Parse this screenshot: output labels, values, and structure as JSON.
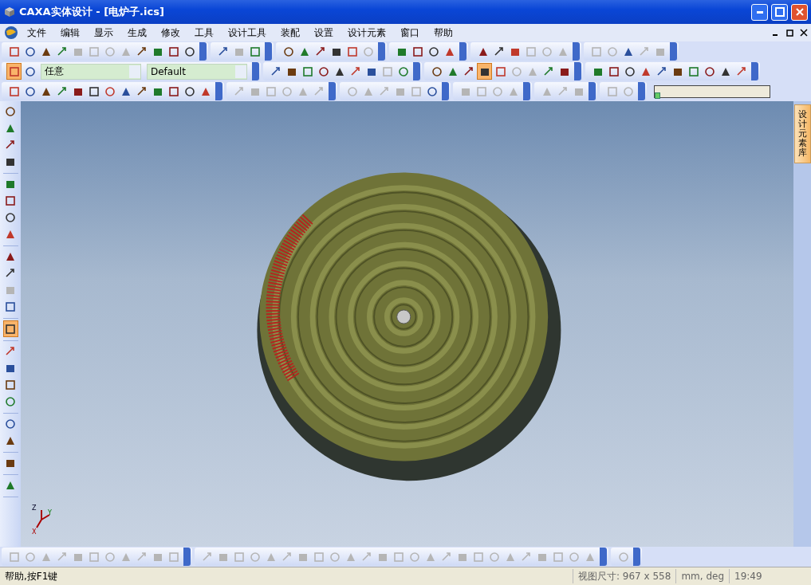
{
  "window": {
    "title": "CAXA实体设计 - [电炉子.ics]"
  },
  "menu": [
    "文件",
    "编辑",
    "显示",
    "生成",
    "修改",
    "工具",
    "设计工具",
    "装配",
    "设置",
    "设计元素",
    "窗口",
    "帮助"
  ],
  "toolbar_rows": [
    [
      {
        "items": [
          {
            "disabled": false
          },
          {
            "disabled": false
          },
          {
            "disabled": false
          },
          {
            "disabled": false
          },
          {
            "disabled": true
          },
          {
            "disabled": true
          },
          {
            "disabled": true
          },
          {
            "disabled": true
          },
          {
            "disabled": false
          },
          {
            "disabled": false
          },
          {
            "disabled": false
          },
          {
            "disabled": false
          }
        ]
      },
      {
        "items": [
          {
            "disabled": false
          },
          {
            "disabled": true
          },
          {
            "disabled": false
          }
        ]
      },
      {
        "items": [
          {
            "disabled": false
          },
          {
            "disabled": false
          },
          {
            "disabled": false
          },
          {
            "disabled": false
          },
          {
            "disabled": false
          },
          {
            "disabled": true
          }
        ]
      },
      {
        "items": [
          {
            "disabled": false
          },
          {
            "disabled": false
          },
          {
            "disabled": false
          },
          {
            "disabled": false
          }
        ]
      },
      {
        "items": [
          {
            "disabled": false
          },
          {
            "disabled": false
          },
          {
            "disabled": false
          },
          {
            "disabled": true
          },
          {
            "disabled": true
          },
          {
            "disabled": true
          }
        ]
      },
      {
        "items": [
          {
            "disabled": true
          },
          {
            "disabled": true
          },
          {
            "disabled": false
          },
          {
            "disabled": true
          },
          {
            "disabled": true
          }
        ]
      }
    ],
    [
      {
        "items": [
          {
            "disabled": false,
            "selected": true
          },
          {
            "disabled": false,
            "selected": false
          }
        ]
      },
      {
        "items": [
          {
            "disabled": false
          },
          {
            "disabled": false
          },
          {
            "disabled": false
          },
          {
            "disabled": false
          },
          {
            "disabled": false
          },
          {
            "disabled": false
          },
          {
            "disabled": false
          },
          {
            "disabled": true
          },
          {
            "disabled": false
          }
        ]
      },
      {
        "items": [
          {
            "disabled": false,
            "selected": false
          },
          {
            "disabled": false,
            "selected": false
          },
          {
            "disabled": false,
            "selected": false
          },
          {
            "disabled": false,
            "selected": true
          },
          {
            "disabled": false,
            "selected": false
          },
          {
            "disabled": true,
            "selected": false
          },
          {
            "disabled": true,
            "selected": false
          },
          {
            "disabled": false,
            "selected": false
          },
          {
            "disabled": false,
            "selected": false
          }
        ]
      },
      {
        "items": [
          {
            "disabled": false
          },
          {
            "disabled": false
          },
          {
            "disabled": false
          },
          {
            "disabled": false
          },
          {
            "disabled": false
          },
          {
            "disabled": false
          },
          {
            "disabled": false
          },
          {
            "disabled": false
          },
          {
            "disabled": false
          },
          {
            "disabled": false
          }
        ]
      }
    ],
    [
      {
        "items": [
          {
            "disabled": false
          },
          {
            "disabled": false
          },
          {
            "disabled": false
          },
          {
            "disabled": false
          },
          {
            "disabled": false
          },
          {
            "disabled": false
          },
          {
            "disabled": false
          },
          {
            "disabled": false
          },
          {
            "disabled": false
          },
          {
            "disabled": false
          },
          {
            "disabled": false
          },
          {
            "disabled": false
          },
          {
            "disabled": false
          }
        ]
      },
      {
        "items": [
          {
            "disabled": true
          },
          {
            "disabled": true
          },
          {
            "disabled": true
          },
          {
            "disabled": true
          },
          {
            "disabled": true
          },
          {
            "disabled": true
          }
        ]
      },
      {
        "items": [
          {
            "disabled": true
          },
          {
            "disabled": true
          },
          {
            "disabled": true
          },
          {
            "disabled": true
          },
          {
            "disabled": true
          },
          {
            "disabled": false
          }
        ]
      },
      {
        "items": [
          {
            "disabled": true
          },
          {
            "disabled": true
          },
          {
            "disabled": true
          },
          {
            "disabled": true
          }
        ]
      },
      {
        "items": [
          {
            "disabled": true
          },
          {
            "disabled": true
          },
          {
            "disabled": true
          }
        ]
      },
      {
        "items": [
          {
            "disabled": true
          },
          {
            "disabled": true
          }
        ]
      }
    ]
  ],
  "selection_filter": {
    "value": "任意"
  },
  "style_combo": {
    "value": "Default"
  },
  "animation_slider": {
    "level": 0
  },
  "left_toolbar": [
    {
      "items": [
        {
          "disabled": false,
          "selected": false
        },
        {
          "disabled": false,
          "selected": false
        },
        {
          "disabled": false,
          "selected": false
        },
        {
          "disabled": false,
          "selected": false
        }
      ]
    },
    {
      "items": [
        {
          "disabled": false,
          "selected": false
        },
        {
          "disabled": false,
          "selected": false
        },
        {
          "disabled": false,
          "selected": false
        },
        {
          "disabled": false,
          "selected": false
        }
      ]
    },
    {
      "items": [
        {
          "disabled": false,
          "selected": false
        },
        {
          "disabled": false,
          "selected": false
        },
        {
          "disabled": true,
          "selected": false
        },
        {
          "disabled": false,
          "selected": false
        }
      ]
    },
    {
      "items": [
        {
          "disabled": false,
          "selected": true
        }
      ]
    },
    {
      "items": [
        {
          "disabled": false,
          "selected": false
        },
        {
          "disabled": false,
          "selected": false
        },
        {
          "disabled": false,
          "selected": false
        },
        {
          "disabled": false,
          "selected": false
        }
      ]
    },
    {
      "items": [
        {
          "disabled": false,
          "selected": false
        },
        {
          "disabled": false,
          "selected": false
        }
      ]
    },
    {
      "items": [
        {
          "disabled": false,
          "selected": false
        }
      ]
    },
    {
      "items": [
        {
          "disabled": false,
          "selected": false
        }
      ]
    }
  ],
  "side_panel": {
    "tab": "设计元素库"
  },
  "axes": {
    "z": "Z",
    "y": "Y",
    "x": "X"
  },
  "bottom_toolbar": [
    {
      "items": [
        {
          "disabled": true
        },
        {
          "disabled": true
        },
        {
          "disabled": true
        },
        {
          "disabled": true
        },
        {
          "disabled": true
        },
        {
          "disabled": true
        },
        {
          "disabled": true
        },
        {
          "disabled": true
        },
        {
          "disabled": true
        },
        {
          "disabled": true
        },
        {
          "disabled": true
        }
      ]
    },
    {
      "items": [
        {
          "disabled": true
        },
        {
          "disabled": true
        },
        {
          "disabled": true
        },
        {
          "disabled": true
        },
        {
          "disabled": true
        },
        {
          "disabled": true
        },
        {
          "disabled": true
        },
        {
          "disabled": true
        },
        {
          "disabled": true
        },
        {
          "disabled": true
        },
        {
          "disabled": true
        },
        {
          "disabled": true
        },
        {
          "disabled": true
        },
        {
          "disabled": true
        },
        {
          "disabled": true
        },
        {
          "disabled": true
        },
        {
          "disabled": true
        },
        {
          "disabled": true
        },
        {
          "disabled": true
        },
        {
          "disabled": true
        },
        {
          "disabled": true
        },
        {
          "disabled": true
        },
        {
          "disabled": true
        },
        {
          "disabled": true
        },
        {
          "disabled": true
        }
      ]
    },
    {
      "items": [
        {
          "disabled": true
        }
      ]
    }
  ],
  "status_bar": {
    "help": "帮助,按F1键",
    "view_size": "视图尺寸: 967 x 558",
    "units": "mm, deg",
    "time": "19:49"
  }
}
